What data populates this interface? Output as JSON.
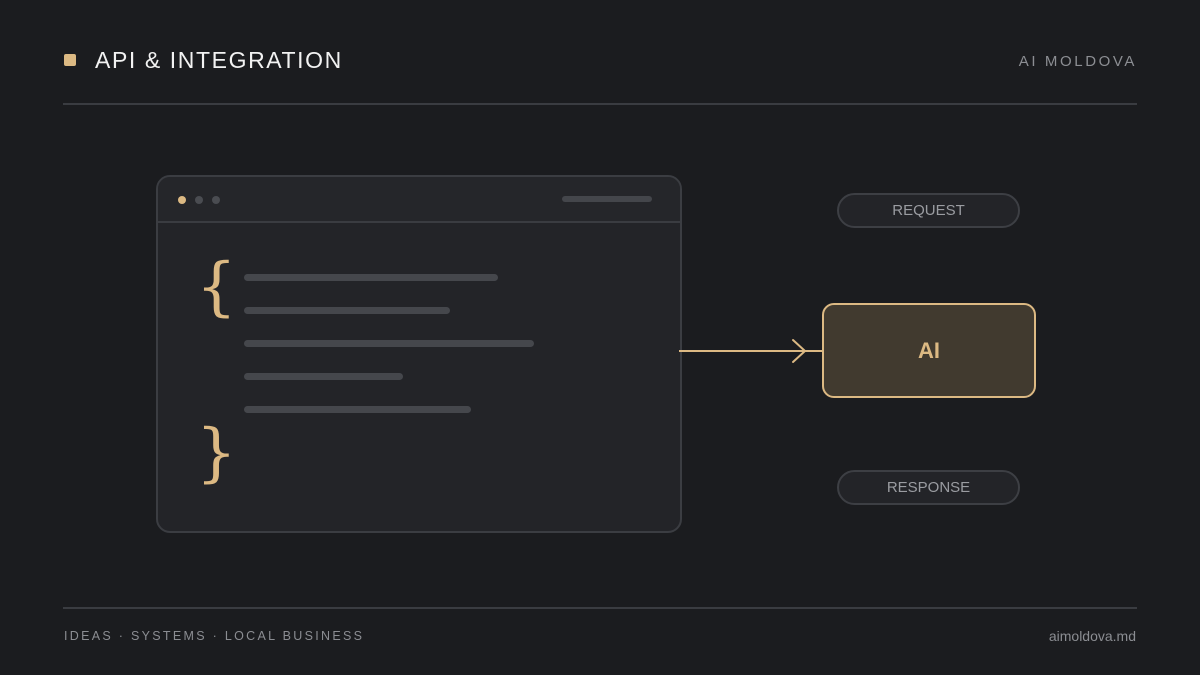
{
  "header": {
    "title": "API & INTEGRATION",
    "brand": "AI MOLDOVA"
  },
  "diagram": {
    "code_window": {
      "open_brace": "{",
      "close_brace": "}"
    },
    "request_label": "REQUEST",
    "ai_label": "AI",
    "response_label": "RESPONSE"
  },
  "footer": {
    "tagline": "IDEAS · SYSTEMS · LOCAL BUSINESS",
    "website": "aimoldova.md"
  },
  "colors": {
    "background": "#1b1c1f",
    "accent": "#dcb983",
    "ai_fill": "#413a2f",
    "muted_text": "#8b8d92"
  }
}
